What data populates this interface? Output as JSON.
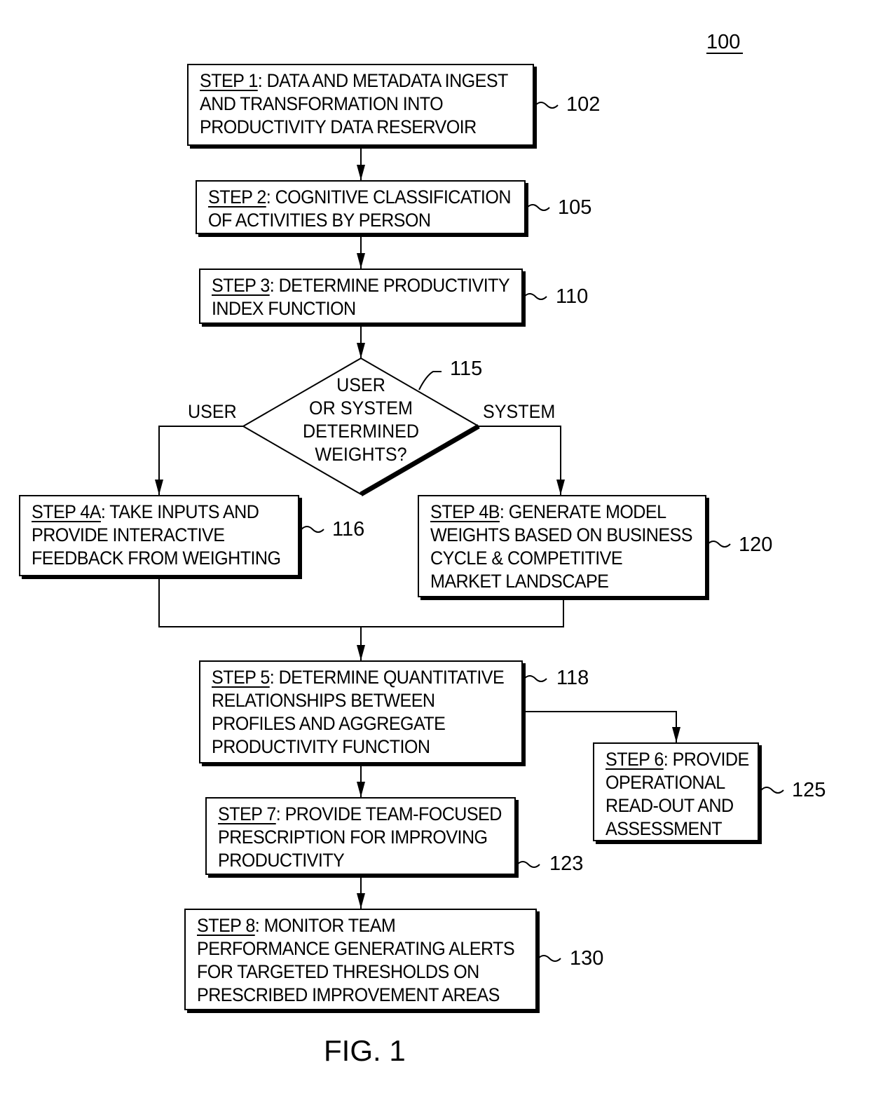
{
  "figure": {
    "reference": "100",
    "caption": "FIG. 1"
  },
  "steps": {
    "s1": {
      "ref": "102",
      "step": "STEP 1",
      "lines": [
        ": DATA AND METADATA INGEST",
        "AND TRANSFORMATION INTO",
        "PRODUCTIVITY DATA RESERVOIR"
      ]
    },
    "s2": {
      "ref": "105",
      "step": "STEP 2",
      "lines": [
        ": COGNITIVE CLASSIFICATION",
        "OF ACTIVITIES BY PERSON"
      ]
    },
    "s3": {
      "ref": "110",
      "step": "STEP 3",
      "lines": [
        ": DETERMINE PRODUCTIVITY",
        "INDEX FUNCTION"
      ]
    },
    "decision": {
      "ref": "115",
      "lines": [
        "USER",
        "OR SYSTEM",
        "DETERMINED",
        "WEIGHTS?"
      ],
      "left_label": "USER",
      "right_label": "SYSTEM"
    },
    "s4a": {
      "ref": "116",
      "step": "STEP 4A",
      "lines": [
        ": TAKE INPUTS AND",
        "PROVIDE INTERACTIVE",
        "FEEDBACK FROM WEIGHTING"
      ]
    },
    "s4b": {
      "ref": "120",
      "step": "STEP 4B",
      "lines": [
        ": GENERATE MODEL",
        "WEIGHTS BASED ON BUSINESS",
        "CYCLE & COMPETITIVE",
        "MARKET LANDSCAPE"
      ]
    },
    "s5": {
      "ref": "118",
      "step": "STEP 5",
      "lines": [
        ": DETERMINE QUANTITATIVE",
        "RELATIONSHIPS BETWEEN",
        "PROFILES AND AGGREGATE",
        "PRODUCTIVITY FUNCTION"
      ]
    },
    "s6": {
      "ref": "125",
      "step": "STEP 6",
      "lines": [
        ": PROVIDE",
        "OPERATIONAL",
        "READ-OUT AND",
        "ASSESSMENT"
      ]
    },
    "s7": {
      "ref": "123",
      "step": "STEP 7",
      "lines": [
        ": PROVIDE TEAM-FOCUSED",
        "PRESCRIPTION FOR IMPROVING",
        "PRODUCTIVITY"
      ]
    },
    "s8": {
      "ref": "130",
      "step": "STEP 8",
      "lines": [
        ": MONITOR TEAM",
        "PERFORMANCE GENERATING ALERTS",
        "FOR TARGETED THRESHOLDS ON",
        "PRESCRIBED IMPROVEMENT AREAS"
      ]
    }
  }
}
